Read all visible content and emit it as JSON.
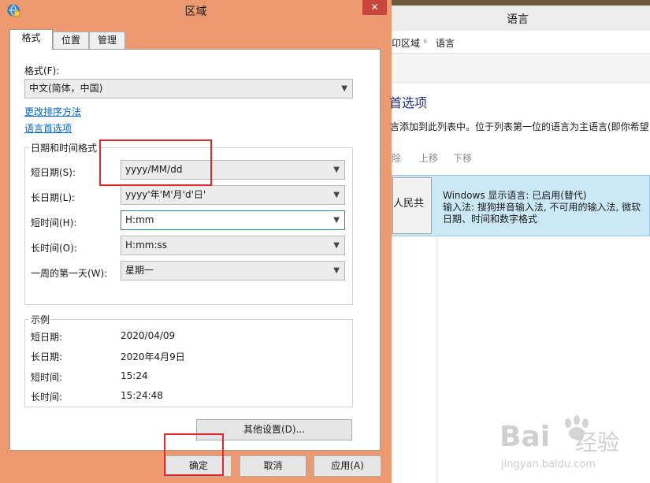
{
  "region_dialog": {
    "title": "区域",
    "close_label": "✕",
    "tabs": [
      {
        "label": "格式",
        "active": true
      },
      {
        "label": "位置",
        "active": false
      },
      {
        "label": "管理",
        "active": false
      }
    ],
    "format_label": "格式(F):",
    "format_value": "中文(简体，中国)",
    "links": {
      "sort_method": "更改排序方法",
      "language_prefs": "语言首选项"
    },
    "datetime_group": {
      "title": "日期和时间格式",
      "fields": [
        {
          "label": "短日期(S):",
          "value": "yyyy/MM/dd"
        },
        {
          "label": "长日期(L):",
          "value": "yyyy'年'M'月'd'日'"
        },
        {
          "label": "短时间(H):",
          "value": "H:mm"
        },
        {
          "label": "长时间(O):",
          "value": "H:mm:ss"
        },
        {
          "label": "一周的第一天(W):",
          "value": "星期一"
        }
      ]
    },
    "example_group": {
      "title": "示例",
      "rows": [
        {
          "label": "短日期:",
          "value": "2020/04/09"
        },
        {
          "label": "长日期:",
          "value": "2020年4月9日"
        },
        {
          "label": "短时间:",
          "value": "15:24"
        },
        {
          "label": "长时间:",
          "value": "15:24:48"
        }
      ]
    },
    "other_settings_button": "其他设置(D)...",
    "ok_button": "确定",
    "cancel_button": "取消",
    "apply_button": "应用(A)"
  },
  "language_window": {
    "title": "语言",
    "breadcrumb_1": "卬区域",
    "breadcrumb_sep": "›",
    "breadcrumb_2": "语言",
    "heading": "首选项",
    "description": "言添加到此列表中。位于列表第一位的语言为主语言(即你希望",
    "toolbar": {
      "remove": "除",
      "move_up": "上移",
      "move_down": "下移"
    },
    "language_item": {
      "name": "人民共",
      "line1": "Windows 显示语言: 已启用(替代)",
      "line2": "输入法: 搜狗拼音输入法, 不可用的输入法, 微软",
      "line3": "日期、时间和数字格式"
    }
  },
  "watermark": {
    "brand": "Bai",
    "brand_cn": "经验",
    "url": "jingyan.baidu.com"
  },
  "colors": {
    "window_frame": "#ee9a70",
    "highlight_box": "#e02a2a",
    "link": "#0066cc",
    "selected_item": "#cbe8f6"
  }
}
